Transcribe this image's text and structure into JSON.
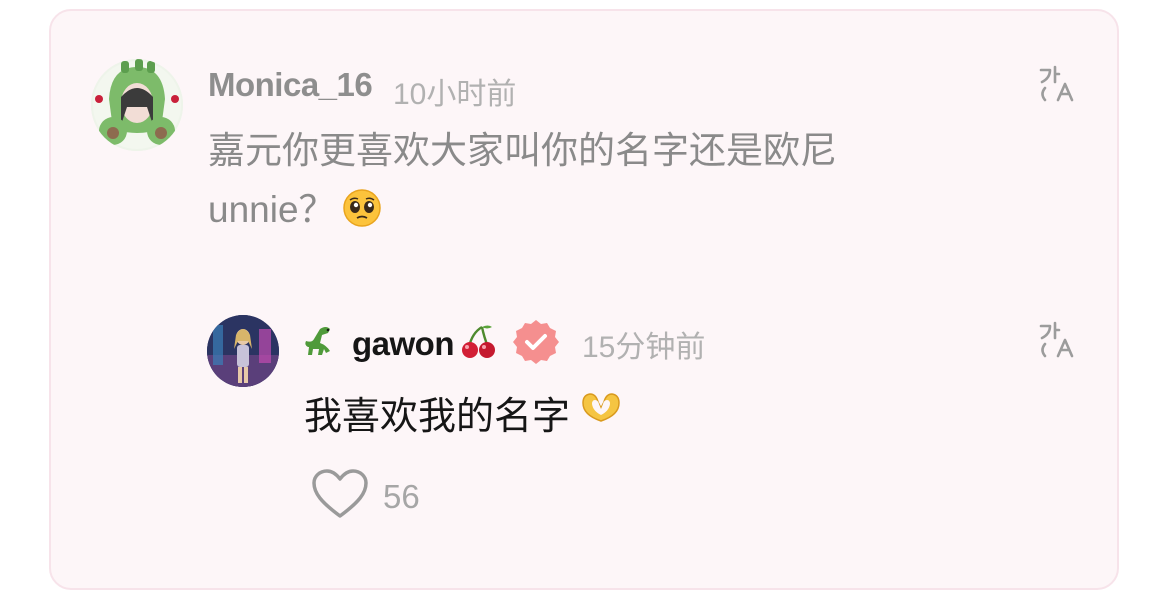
{
  "comment": {
    "username": "Monica_16",
    "time": "10小时前",
    "text": "嘉元你更喜欢大家叫你的名字还是欧尼\nunnie？",
    "emoji": "pleading-face"
  },
  "reply": {
    "username": "gawon",
    "prefix_emoji": "dinosaur",
    "suffix_emoji": "cherries",
    "verified_badge": "verified-badge-icon",
    "time": "15分钟前",
    "text": "我喜欢我的名字",
    "text_emoji": "heart-hands",
    "like_count": "56"
  },
  "icons": {
    "translate": "translate-icon",
    "like": "heart-outline-icon"
  },
  "colors": {
    "card_bg": "#fdf6f8",
    "card_border": "#f7e3ea",
    "verified": "#f58f8f",
    "secondary_text": "#8e8e8e"
  }
}
